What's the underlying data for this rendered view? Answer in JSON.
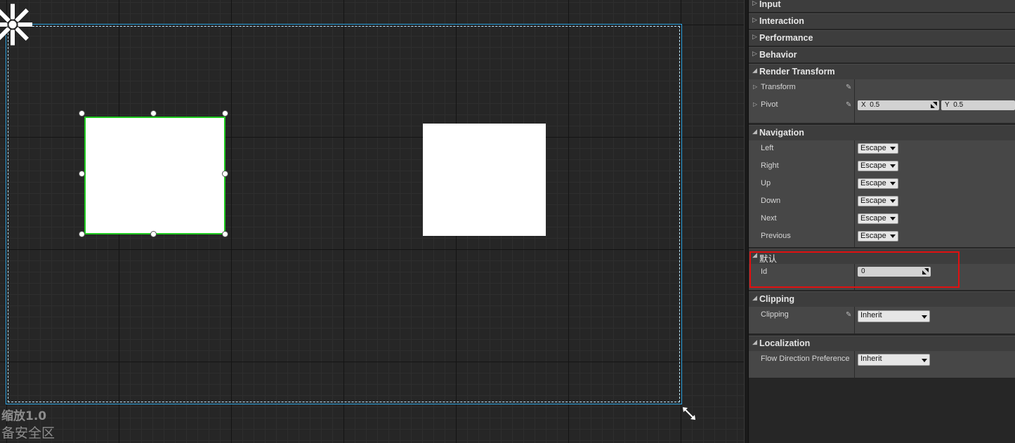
{
  "canvas": {
    "zoom_label": "缩放1.0",
    "safe_zone_label": "备安全区"
  },
  "panel": {
    "categories": {
      "input": "Input",
      "interaction": "Interaction",
      "performance": "Performance",
      "behavior": "Behavior",
      "render_transform": "Render Transform",
      "navigation": "Navigation",
      "default": "默认",
      "clipping": "Clipping",
      "localization": "Localization"
    },
    "render_transform": {
      "transform_label": "Transform",
      "pivot_label": "Pivot",
      "pivot_x_prefix": "X",
      "pivot_x": "0.5",
      "pivot_y_prefix": "Y",
      "pivot_y": "0.5"
    },
    "navigation": [
      {
        "label": "Left",
        "value": "Escape"
      },
      {
        "label": "Right",
        "value": "Escape"
      },
      {
        "label": "Up",
        "value": "Escape"
      },
      {
        "label": "Down",
        "value": "Escape"
      },
      {
        "label": "Next",
        "value": "Escape"
      },
      {
        "label": "Previous",
        "value": "Escape"
      }
    ],
    "default": {
      "id_label": "Id",
      "id_value": "0"
    },
    "clipping": {
      "label": "Clipping",
      "value": "Inherit"
    },
    "localization": {
      "label": "Flow Direction Preference",
      "value": "Inherit"
    }
  },
  "colors": {
    "selection_outline": "#1ec91e",
    "design_frame": "#31a8e6",
    "highlight": "#e01010"
  }
}
